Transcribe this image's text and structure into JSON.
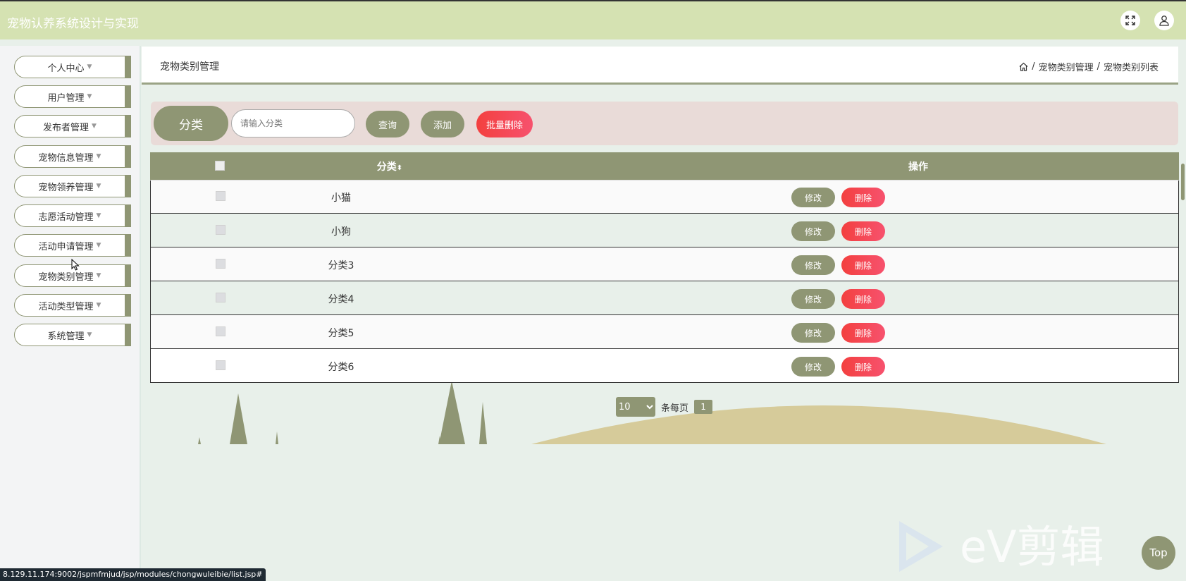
{
  "header": {
    "title": "宠物认养系统设计与实现"
  },
  "sidebar": {
    "items": [
      {
        "label": "个人中心"
      },
      {
        "label": "用户管理"
      },
      {
        "label": "发布者管理"
      },
      {
        "label": "宠物信息管理"
      },
      {
        "label": "宠物领养管理"
      },
      {
        "label": "志愿活动管理"
      },
      {
        "label": "活动申请管理"
      },
      {
        "label": "宠物类别管理"
      },
      {
        "label": "活动类型管理"
      },
      {
        "label": "系统管理"
      }
    ]
  },
  "page": {
    "title": "宠物类别管理",
    "breadcrumb": [
      "宠物类别管理",
      "宠物类别列表"
    ]
  },
  "search": {
    "label": "分类",
    "placeholder": "请输入分类",
    "query_label": "查询",
    "add_label": "添加",
    "batch_delete_label": "批量删除"
  },
  "table": {
    "columns": [
      "分类",
      "操作"
    ],
    "rows": [
      {
        "name": "小猫"
      },
      {
        "name": "小狗"
      },
      {
        "name": "分类3"
      },
      {
        "name": "分类4"
      },
      {
        "name": "分类5"
      },
      {
        "name": "分类6"
      }
    ],
    "edit_label": "修改",
    "delete_label": "删除"
  },
  "pagination": {
    "page_size": "10",
    "per_page_label": "条每页",
    "current_page": "1"
  },
  "status_url": "8.129.11.174:9002/jspmfmjud/jsp/modules/chongwuleibie/list.jsp#",
  "top_label": "Top",
  "colors": {
    "accent": "#8f9674",
    "header": "#d5e2b2",
    "danger": "#f5424f",
    "search_bg": "#e9dbd8"
  }
}
